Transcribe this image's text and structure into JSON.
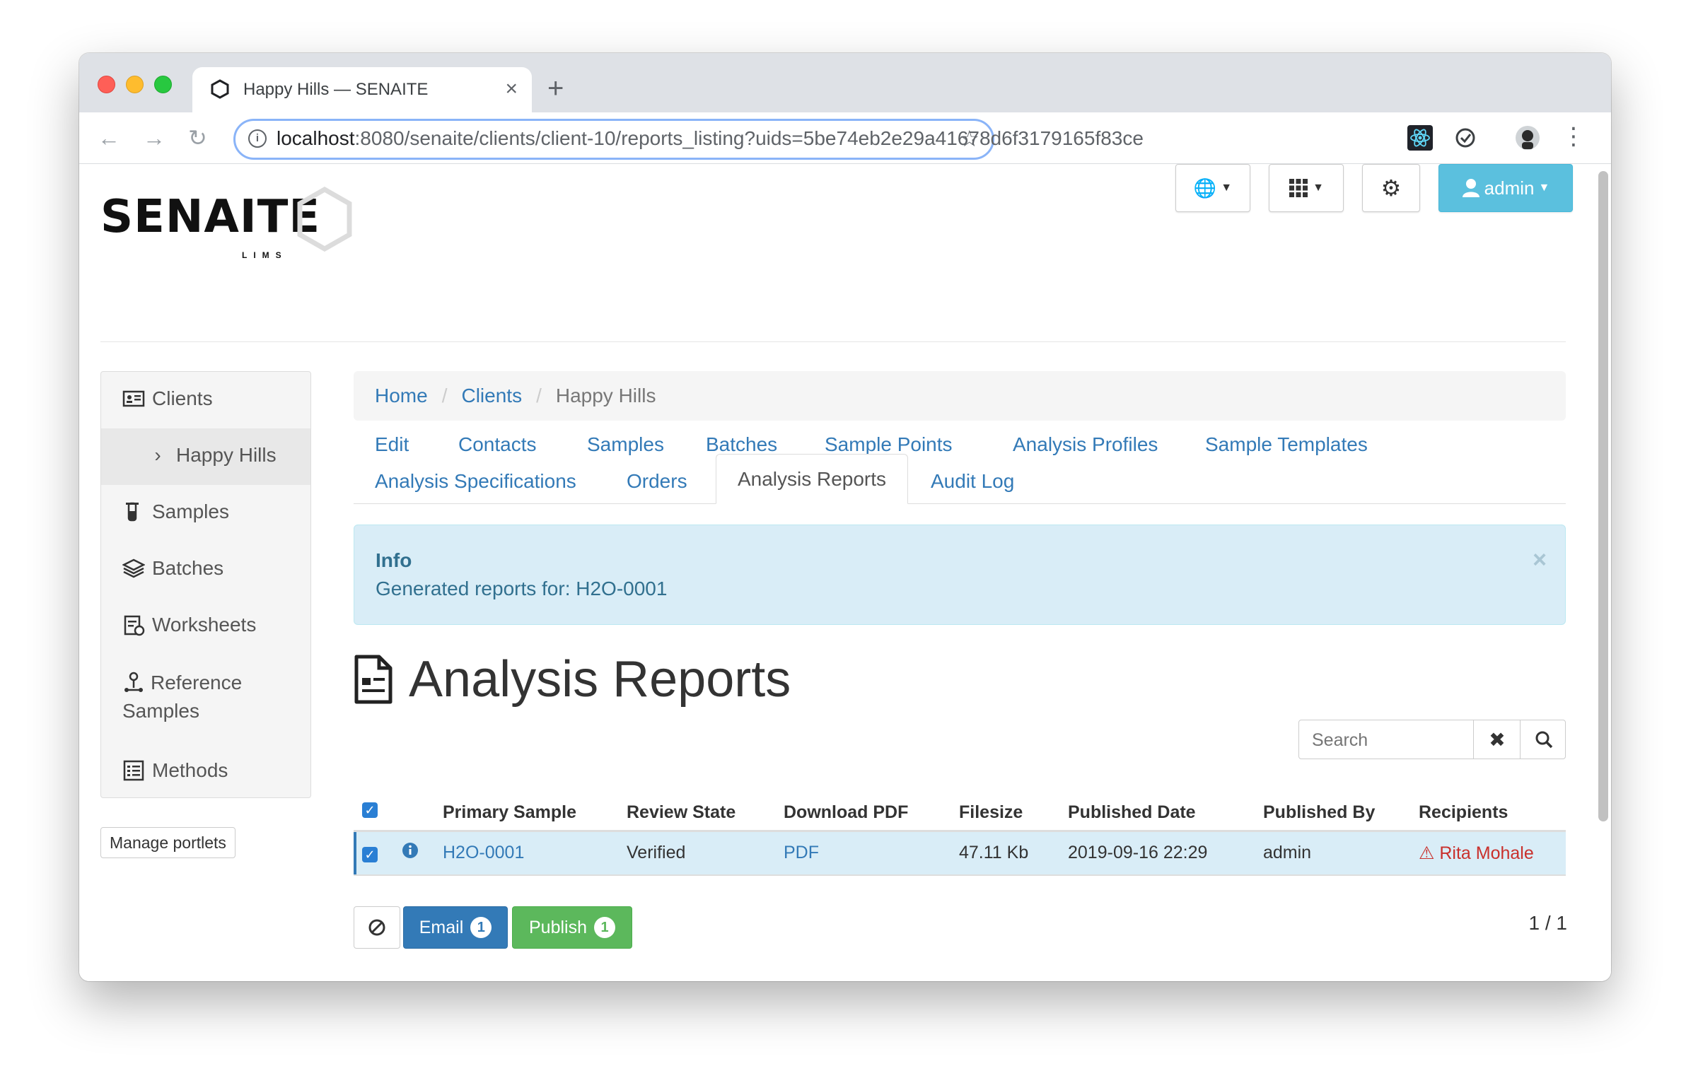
{
  "browser": {
    "tab_title": "Happy Hills — SENAITE",
    "new_tab_label": "+",
    "close_tab_label": "×",
    "url_host": "localhost",
    "url_rest": ":8080/senaite/clients/client-10/reports_listing?uids=5be74eb2e29a41678d6f3179165f83ce"
  },
  "header": {
    "logo_text": "SENAITE",
    "logo_sub": "LIMS",
    "user_button": "admin"
  },
  "sidebar": {
    "items": [
      {
        "label": "Clients",
        "icon": "client-card-icon"
      },
      {
        "label": "Happy Hills",
        "icon": "chevron-right-icon"
      },
      {
        "label": "Samples",
        "icon": "sample-tube-icon"
      },
      {
        "label": "Batches",
        "icon": "layers-icon"
      },
      {
        "label": "Worksheets",
        "icon": "worksheet-icon"
      },
      {
        "label": "Reference Samples",
        "icon": "reference-sample-icon"
      },
      {
        "label": "Methods",
        "icon": "methods-icon"
      }
    ],
    "manage_portlets": "Manage portlets"
  },
  "breadcrumb": {
    "home": "Home",
    "clients": "Clients",
    "current": "Happy Hills",
    "separator": "/"
  },
  "tabs": {
    "row1": [
      "Edit",
      "Contacts",
      "Samples",
      "Batches",
      "Sample Points",
      "Analysis Profiles",
      "Sample Templates"
    ],
    "row2": [
      "Analysis Specifications",
      "Orders",
      "Analysis Reports",
      "Audit Log"
    ],
    "active": "Analysis Reports"
  },
  "alert": {
    "title": "Info",
    "message": "Generated reports for: H2O-0001",
    "close": "×"
  },
  "page_title": "Analysis Reports",
  "search": {
    "placeholder": "Search"
  },
  "table": {
    "columns": [
      "Primary Sample",
      "Review State",
      "Download PDF",
      "Filesize",
      "Published Date",
      "Published By",
      "Recipients"
    ],
    "rows": [
      {
        "primary_sample": "H2O-0001",
        "review_state": "Verified",
        "download_pdf": "PDF",
        "filesize": "47.11 Kb",
        "published_date": "2019-09-16 22:29",
        "published_by": "admin",
        "recipients": "Rita Mohale",
        "selected": true
      }
    ]
  },
  "actions": {
    "email": "Email",
    "email_count": "1",
    "publish": "Publish",
    "publish_count": "1"
  },
  "pagination": "1 / 1",
  "colors": {
    "link": "#337ab7",
    "info_bg": "#d9edf7",
    "success": "#5cb85c",
    "admin_btn": "#5bc0de",
    "warning": "#c9302c"
  }
}
